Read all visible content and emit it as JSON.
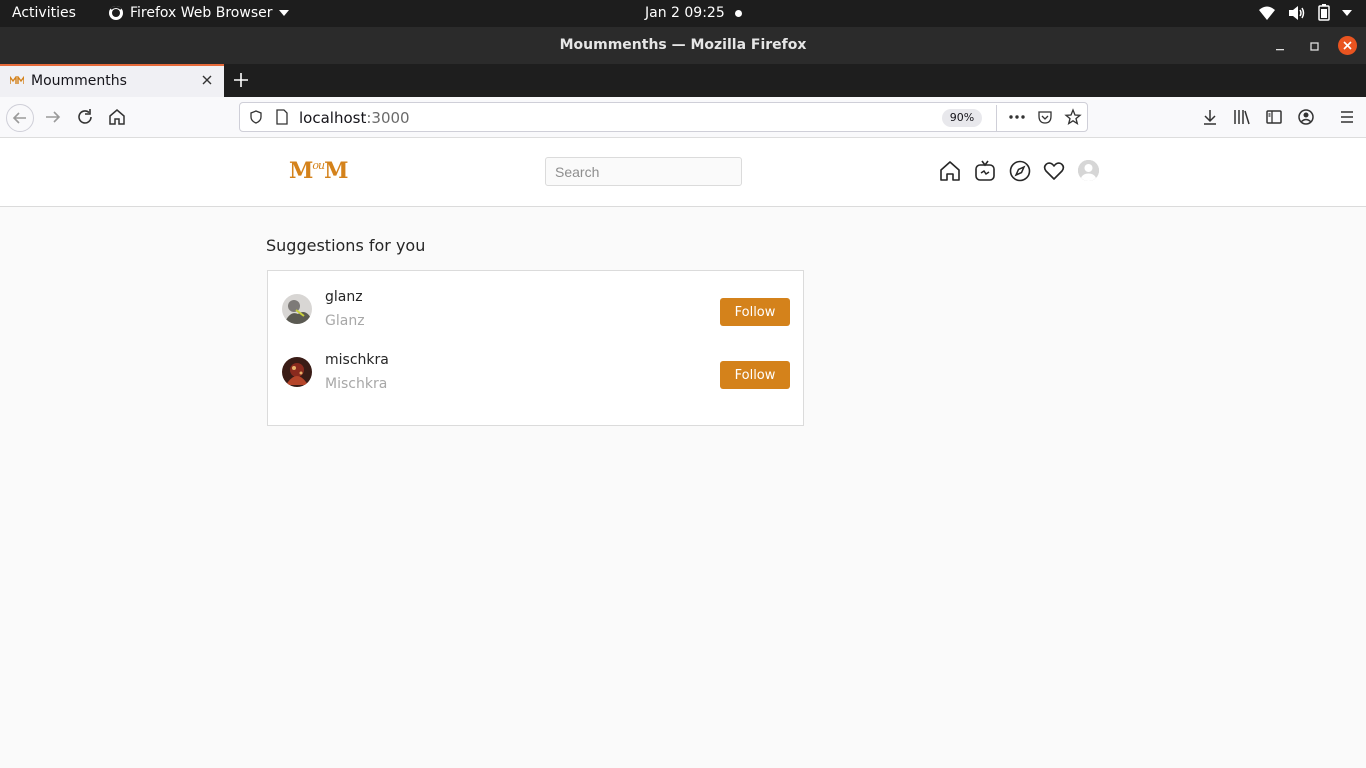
{
  "system": {
    "activities": "Activities",
    "app_name": "Firefox Web Browser",
    "clock": "Jan 2  09:25"
  },
  "window": {
    "title": "Moummenths — Mozilla Firefox"
  },
  "browser": {
    "tab_title": "Moummenths",
    "url_host": "localhost",
    "url_port": ":3000",
    "zoom": "90%"
  },
  "app": {
    "logo_left": "M",
    "logo_ou": "ou",
    "logo_right": "M",
    "search_placeholder": "Search",
    "nav_icons": [
      "home-icon",
      "tv-icon",
      "compass-icon",
      "heart-icon",
      "profile-avatar"
    ]
  },
  "suggestions": {
    "heading": "Suggestions for you",
    "items": [
      {
        "username": "glanz",
        "fullname": "Glanz",
        "button": "Follow"
      },
      {
        "username": "mischkra",
        "fullname": "Mischkra",
        "button": "Follow"
      }
    ]
  },
  "colors": {
    "accent": "#d4821b",
    "ubuntu_orange": "#e95420"
  }
}
